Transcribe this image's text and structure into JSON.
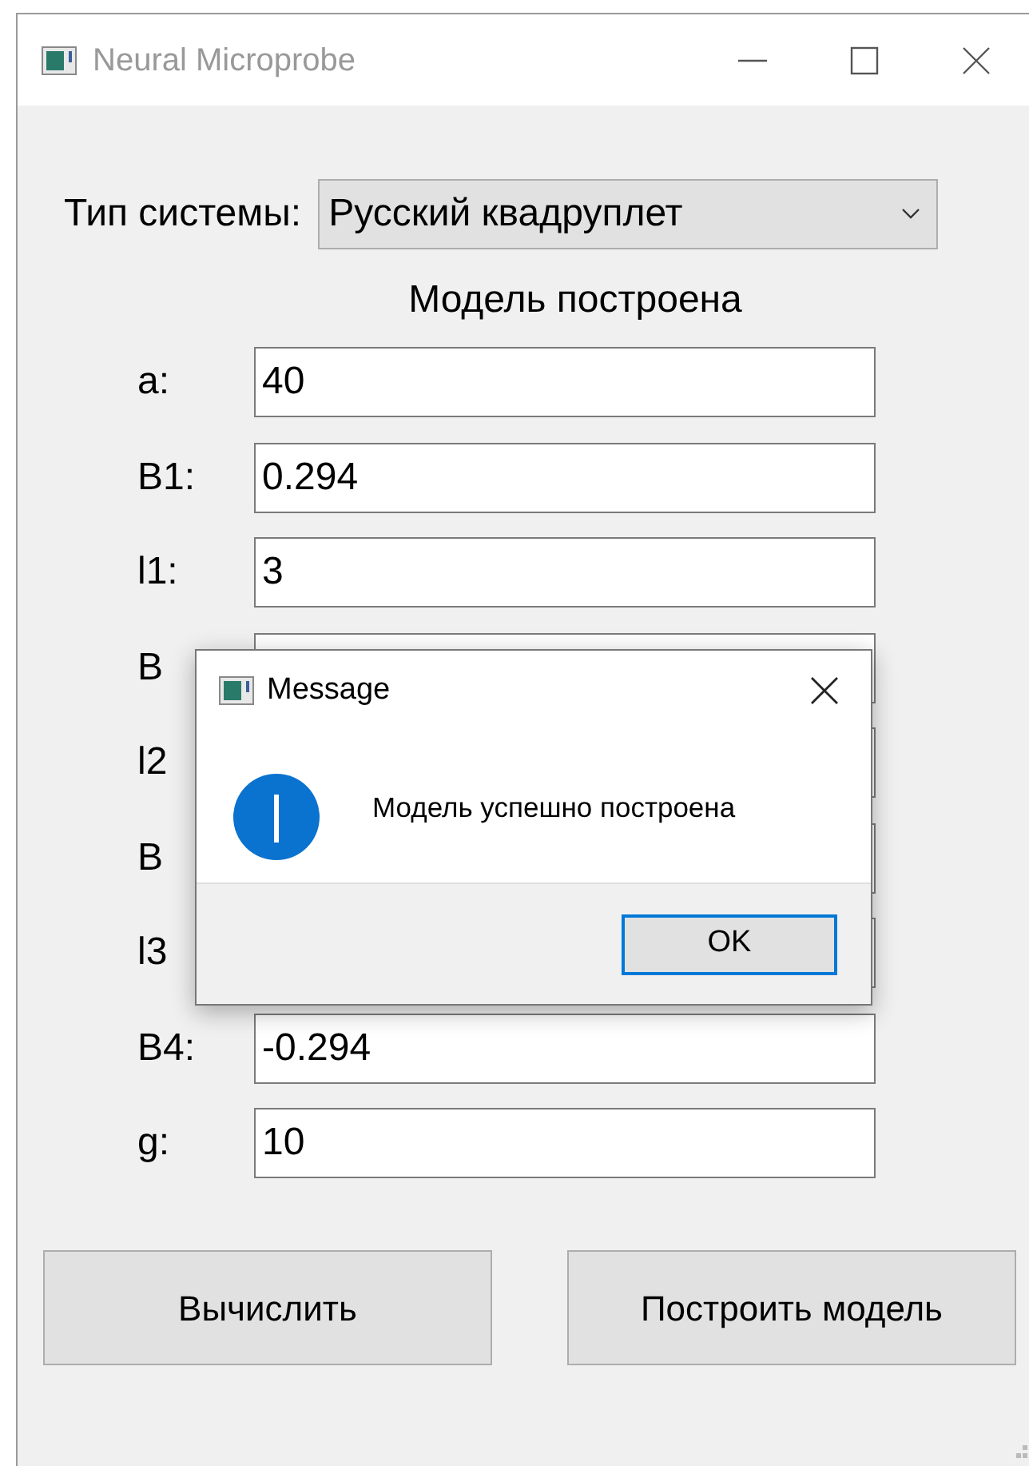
{
  "window": {
    "title": "Neural Microprobe"
  },
  "system_type": {
    "label": "Тип системы:",
    "value": "Русский квадруплет"
  },
  "status": "Модель построена",
  "fields": [
    {
      "label": "a:",
      "value": "40"
    },
    {
      "label": "B1:",
      "value": "0.294"
    },
    {
      "label": "l1:",
      "value": "3"
    },
    {
      "label": "B"
    },
    {
      "label": "l2"
    },
    {
      "label": "B"
    },
    {
      "label": "l3"
    },
    {
      "label": "B4:",
      "value": "-0.294"
    },
    {
      "label": "g:",
      "value": "10"
    }
  ],
  "buttons": [
    "Вычислить",
    "Построить модель"
  ],
  "dialog": {
    "title": "Message",
    "kind": "info",
    "message": "Модель успешно построена",
    "buttons": [
      {
        "label": "OK",
        "focused": true
      }
    ]
  }
}
